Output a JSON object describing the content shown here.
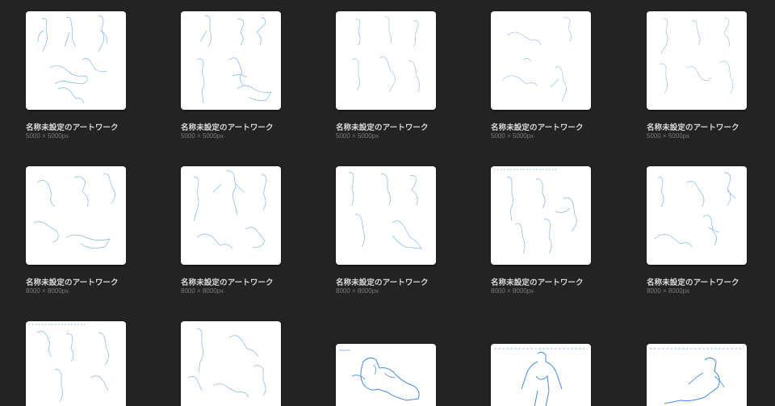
{
  "gallery": {
    "items": [
      {
        "title": "名称未設定のアートワーク",
        "dims": "5000 × 5000px"
      },
      {
        "title": "名称未設定のアートワーク",
        "dims": "5000 × 5000px"
      },
      {
        "title": "名称未設定のアートワーク",
        "dims": "5000 × 5000px"
      },
      {
        "title": "名称未設定のアートワーク",
        "dims": "5000 × 5000px"
      },
      {
        "title": "名称未設定のアートワーク",
        "dims": "5000 × 5000px"
      },
      {
        "title": "名称未設定のアートワーク",
        "dims": "8000 × 8000px"
      },
      {
        "title": "名称未設定のアートワーク",
        "dims": "8000 × 8000px"
      },
      {
        "title": "名称未設定のアートワーク",
        "dims": "8000 × 8000px"
      },
      {
        "title": "名称未設定のアートワーク",
        "dims": "8000 × 8000px"
      },
      {
        "title": "名称未設定のアートワーク",
        "dims": "8000 × 8000px"
      },
      {
        "title": "",
        "dims": ""
      },
      {
        "title": "",
        "dims": ""
      },
      {
        "title": "",
        "dims": ""
      },
      {
        "title": "",
        "dims": ""
      },
      {
        "title": "",
        "dims": ""
      }
    ]
  },
  "colors": {
    "background": "#232323",
    "sketch_line": "#4a90e2",
    "title_text": "#d8d8d8",
    "dims_text": "#7a7a7a"
  }
}
